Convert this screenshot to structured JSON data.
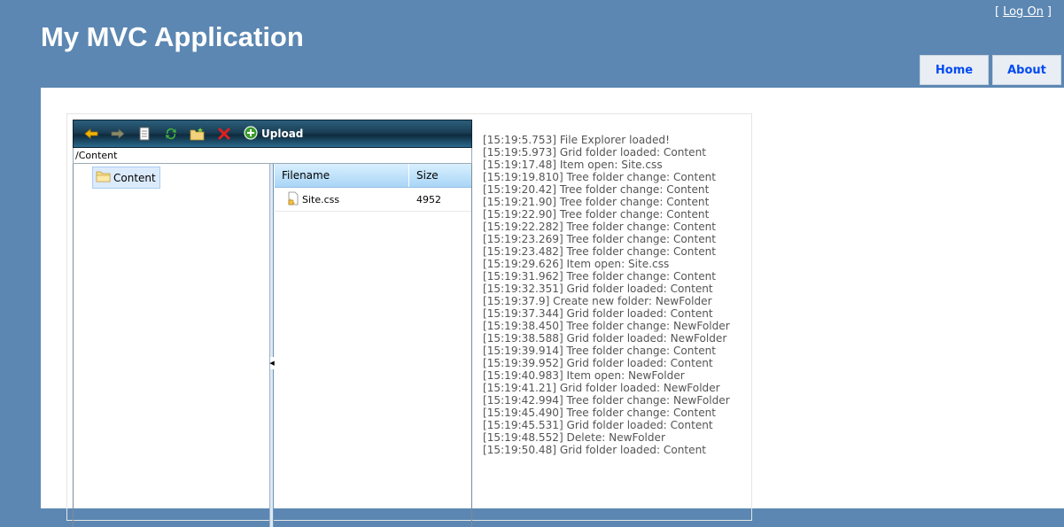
{
  "header": {
    "title": "My MVC Application",
    "login_open": "[",
    "login_label": "Log On",
    "login_close": "]"
  },
  "menu": {
    "items": [
      {
        "label": "Home"
      },
      {
        "label": "About"
      }
    ]
  },
  "colors": {
    "header_bg": "#5c87b2",
    "menu_link": "#034af3"
  },
  "file_explorer": {
    "toolbar": {
      "icons": [
        "back-arrow-icon",
        "forward-arrow-icon",
        "new-document-icon",
        "refresh-icon",
        "new-folder-icon",
        "delete-icon",
        "upload-icon"
      ],
      "upload_label": "Upload"
    },
    "path": "/Content",
    "tree": {
      "nodes": [
        {
          "label": "Content",
          "icon": "folder-icon"
        }
      ]
    },
    "grid": {
      "columns": [
        "Filename",
        "Size"
      ],
      "rows": [
        {
          "filename": "Site.css",
          "size": "4952",
          "icon": "css-file-icon"
        }
      ]
    }
  },
  "log": {
    "entries": [
      "[15:19:5.753] File Explorer loaded!",
      "[15:19:5.973] Grid folder loaded: Content",
      "[15:19:17.48] Item open: Site.css",
      "[15:19:19.810] Tree folder change: Content",
      "[15:19:20.42] Tree folder change: Content",
      "[15:19:21.90] Tree folder change: Content",
      "[15:19:22.90] Tree folder change: Content",
      "[15:19:22.282] Tree folder change: Content",
      "[15:19:23.269] Tree folder change: Content",
      "[15:19:23.482] Tree folder change: Content",
      "[15:19:29.626] Item open: Site.css",
      "[15:19:31.962] Tree folder change: Content",
      "[15:19:32.351] Grid folder loaded: Content",
      "[15:19:37.9] Create new folder: NewFolder",
      "[15:19:37.344] Grid folder loaded: Content",
      "[15:19:38.450] Tree folder change: NewFolder",
      "[15:19:38.588] Grid folder loaded: NewFolder",
      "[15:19:39.914] Tree folder change: Content",
      "[15:19:39.952] Grid folder loaded: Content",
      "[15:19:40.983] Item open: NewFolder",
      "[15:19:41.21] Grid folder loaded: NewFolder",
      "[15:19:42.994] Tree folder change: NewFolder",
      "[15:19:45.490] Tree folder change: Content",
      "[15:19:45.531] Grid folder loaded: Content",
      "[15:19:48.552] Delete: NewFolder",
      "[15:19:50.48] Grid folder loaded: Content"
    ]
  }
}
